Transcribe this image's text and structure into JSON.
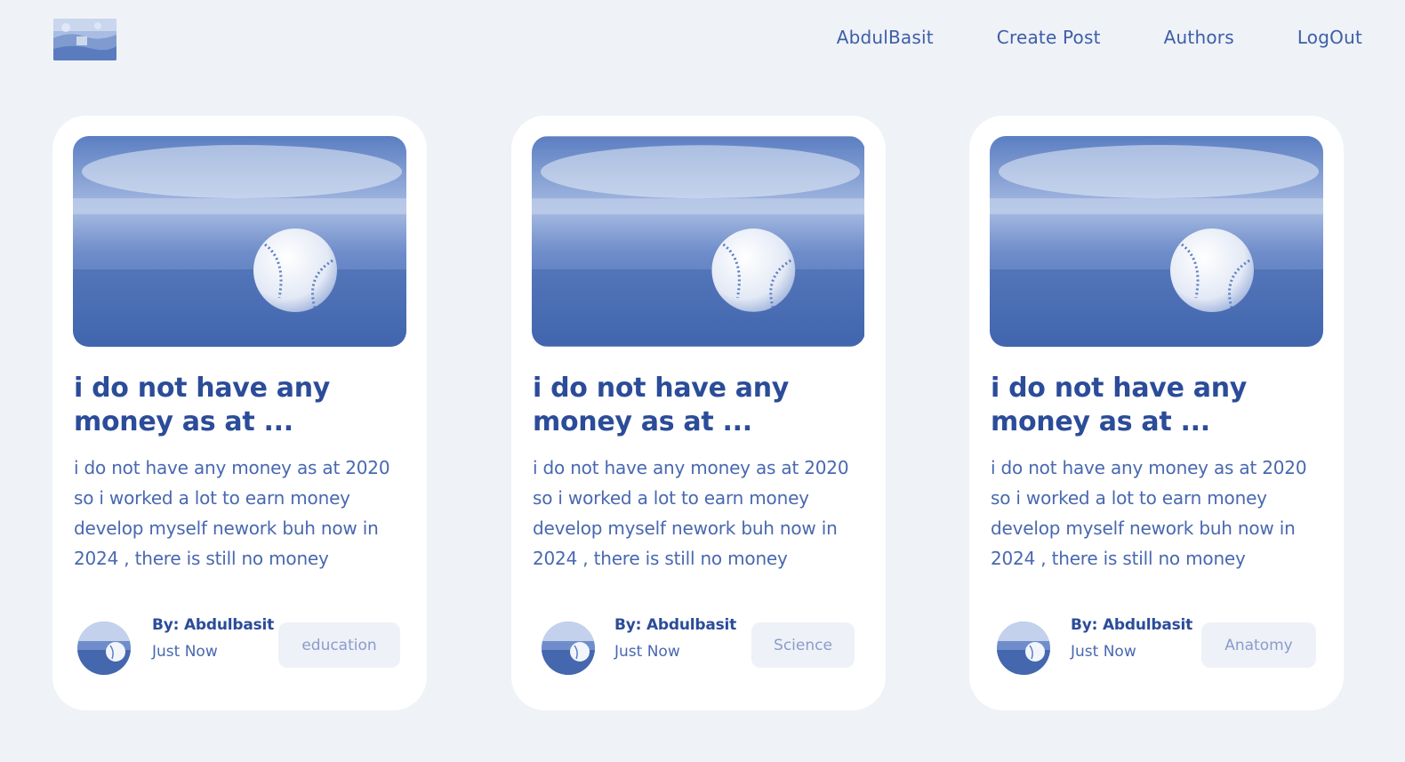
{
  "nav": {
    "links": [
      "AbdulBasit",
      "Create Post",
      "Authors",
      "LogOut"
    ]
  },
  "posts": [
    {
      "title": "i do not have any money as at ...",
      "body": "i do not have any money as at 2020 so i worked a lot to earn money develop myself nework buh now in 2024 , there is still no money",
      "author": "By: Abdulbasit",
      "time": "Just Now",
      "category": "education"
    },
    {
      "title": "i do not have any money as at ...",
      "body": "i do not have any money as at 2020 so i worked a lot to earn money develop myself nework buh now in 2024 , there is still no money",
      "author": "By: Abdulbasit",
      "time": "Just Now",
      "category": "Science"
    },
    {
      "title": "i do not have any money as at ...",
      "body": "i do not have any money as at 2020 so i worked a lot to earn money develop myself nework buh now in 2024 , there is still no money",
      "author": "By: Abdulbasit",
      "time": "Just Now",
      "category": "Anatomy"
    }
  ],
  "colors": {
    "background": "#eff2f7",
    "card": "#ffffff",
    "primary": "#2b4c99",
    "text": "#4868b0",
    "tag_bg": "#eef1f7",
    "tag_text": "#8a9ccc"
  },
  "icons": {
    "logo": "site-logo",
    "post_image": "baseball-on-grass-photo",
    "avatar": "author-avatar"
  }
}
